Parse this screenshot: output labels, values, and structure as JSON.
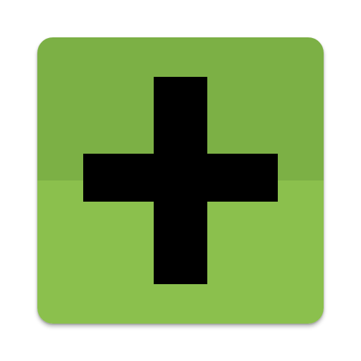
{
  "icon": {
    "name": "plus-icon",
    "glyph_color": "#000000",
    "background_top_color": "#7cb045",
    "background_bottom_color": "#8bc04d"
  }
}
